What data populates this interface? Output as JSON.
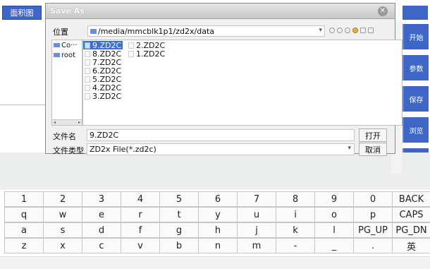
{
  "app": {
    "top_tab": "面积图",
    "right_buttons": [
      "开始",
      "参数",
      "保存",
      "浏览"
    ]
  },
  "dialog": {
    "title": "Save As",
    "location_label": "位置",
    "location_path": "/media/mmcblk1p1/zd2x/data",
    "side_items": [
      "Co···",
      "root"
    ],
    "files_col1": [
      "9.ZD2C",
      "8.ZD2C",
      "7.ZD2C",
      "6.ZD2C",
      "5.ZD2C",
      "4.ZD2C",
      "3.ZD2C"
    ],
    "files_col2": [
      "2.ZD2C",
      "1.ZD2C"
    ],
    "selected_file": "9.ZD2C",
    "filename_label": "文件名",
    "filename_value": "9.ZD2C",
    "open_label": "打开",
    "filetype_label": "文件类型",
    "filetype_value": "ZD2x File(*.zd2c)",
    "cancel_label": "取消"
  },
  "keyboard": {
    "rows": [
      [
        "1",
        "2",
        "3",
        "4",
        "5",
        "6",
        "7",
        "8",
        "9",
        "0",
        "BACK"
      ],
      [
        "q",
        "w",
        "e",
        "r",
        "t",
        "y",
        "u",
        "i",
        "o",
        "p",
        "CAPS"
      ],
      [
        "a",
        "s",
        "d",
        "f",
        "g",
        "h",
        "j",
        "k",
        "l",
        "PG_UP",
        "PG_DN"
      ],
      [
        "z",
        "x",
        "c",
        "v",
        "b",
        "n",
        "m",
        "-",
        "_",
        ".",
        "英"
      ]
    ]
  }
}
